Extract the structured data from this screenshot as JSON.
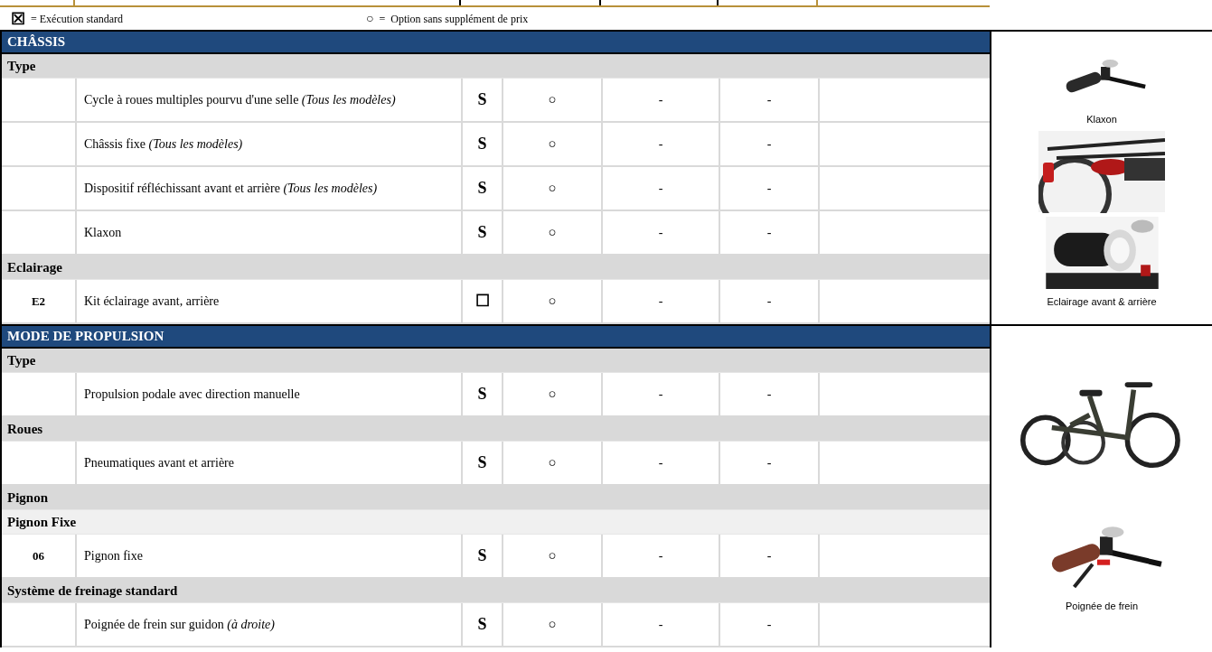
{
  "legend": [
    {
      "symbol": "☒",
      "text": "= Exécution standard"
    },
    {
      "symbol": "○",
      "text": "=  Option sans supplément de prix"
    }
  ],
  "sections": [
    {
      "title": "CHÂSSIS",
      "rows": [
        {
          "kind": "group",
          "label": "Type"
        },
        {
          "kind": "item",
          "code": "",
          "description": "Cycle à roues multiples pourvu d'une selle *(Tous les modèles)*",
          "standard": "S",
          "option": "○",
          "column_5": "-",
          "column_6": "-"
        },
        {
          "kind": "item",
          "code": "",
          "description": "Châssis fixe *(Tous les modèles)*",
          "standard": "S",
          "option": "○",
          "column_5": "-",
          "column_6": "-"
        },
        {
          "kind": "item",
          "code": "",
          "description": "Dispositif réfléchissant avant et arrière *(Tous les modèles)*",
          "standard": "S",
          "option": "○",
          "column_5": "-",
          "column_6": "-"
        },
        {
          "kind": "item",
          "code": "",
          "description": "Klaxon",
          "standard": "S",
          "option": "○",
          "column_5": "-",
          "column_6": "-"
        },
        {
          "kind": "group",
          "label": "Eclairage"
        },
        {
          "kind": "item",
          "code": "E2",
          "description": "Kit éclairage avant, arrière",
          "standard": "☐",
          "option": "○",
          "column_5": "-",
          "column_6": "-"
        }
      ],
      "images": [
        {
          "kind": "picture",
          "caption": "Klaxon"
        },
        {
          "kind": "picture"
        },
        {
          "kind": "picture",
          "caption": "Eclairage avant & arrière"
        }
      ]
    },
    {
      "title": "MODE DE PROPULSION",
      "rows": [
        {
          "kind": "group",
          "label": "Type"
        },
        {
          "kind": "item",
          "code": "",
          "description": "Propulsion podale avec direction manuelle",
          "standard": "S",
          "option": "○",
          "column_5": "-",
          "column_6": "-"
        },
        {
          "kind": "group",
          "label": "Roues"
        },
        {
          "kind": "item",
          "code": "",
          "description": "Pneumatiques avant et arrière",
          "standard": "S",
          "option": "○",
          "column_5": "-",
          "column_6": "-"
        },
        {
          "kind": "group",
          "label": "Pignon"
        },
        {
          "kind": "subgroup",
          "label": "Pignon Fixe"
        },
        {
          "kind": "item",
          "code": "06",
          "description": "Pignon fixe",
          "standard": "S",
          "option": "○",
          "column_5": "-",
          "column_6": "-"
        },
        {
          "kind": "group",
          "label": "Système de freinage standard"
        },
        {
          "kind": "item",
          "code": "",
          "description": "Poignée de frein sur guidon *(à droite)*",
          "standard": "S",
          "option": "○",
          "column_5": "-",
          "column_6": "-"
        }
      ],
      "images": [
        {
          "kind": "picture"
        },
        {
          "kind": "picture",
          "caption": "Poignée de frein"
        }
      ]
    }
  ]
}
